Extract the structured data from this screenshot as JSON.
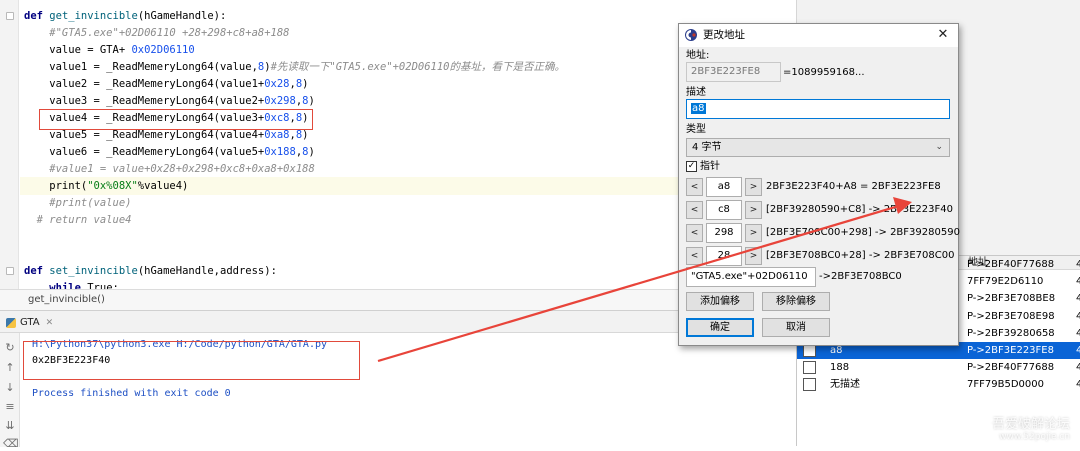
{
  "editor": {
    "lines": [
      {
        "parts": [
          [
            "kw",
            "def "
          ],
          [
            "fn",
            "get_invincible"
          ],
          [
            "plain",
            "(hGameHandle):"
          ]
        ]
      },
      {
        "parts": [
          [
            "cmt",
            "    #\"GTA5.exe\"+02D06110 +28+298+c8+a8+188"
          ]
        ]
      },
      {
        "parts": [
          [
            "plain",
            "    value = GTA+ "
          ],
          [
            "num",
            "0x02D06110"
          ]
        ]
      },
      {
        "parts": [
          [
            "plain",
            "    value1 = _ReadMemeryLong64(value,"
          ],
          [
            "num",
            "8"
          ],
          [
            "plain",
            ")"
          ],
          [
            "cmt",
            "#先读取一下\"GTA5.exe\"+02D06110的基址，看下是否正确。"
          ]
        ]
      },
      {
        "parts": [
          [
            "plain",
            "    value2 = _ReadMemeryLong64(value1+"
          ],
          [
            "num",
            "0x28"
          ],
          [
            "plain",
            ","
          ],
          [
            "num",
            "8"
          ],
          [
            "plain",
            ")"
          ]
        ]
      },
      {
        "parts": [
          [
            "plain",
            "    value3 = _ReadMemeryLong64(value2+"
          ],
          [
            "num",
            "0x298"
          ],
          [
            "plain",
            ","
          ],
          [
            "num",
            "8"
          ],
          [
            "plain",
            ")"
          ]
        ]
      },
      {
        "parts": [
          [
            "plain",
            "    value4 = _ReadMemeryLong64(value3+"
          ],
          [
            "num",
            "0xc8"
          ],
          [
            "plain",
            ","
          ],
          [
            "num",
            "8"
          ],
          [
            "plain",
            ")"
          ]
        ]
      },
      {
        "parts": [
          [
            "plain",
            "    value5 = _ReadMemeryLong64(value4+"
          ],
          [
            "num",
            "0xa8"
          ],
          [
            "plain",
            ","
          ],
          [
            "num",
            "8"
          ],
          [
            "plain",
            ")"
          ]
        ]
      },
      {
        "parts": [
          [
            "plain",
            "    value6 = _ReadMemeryLong64(value5+"
          ],
          [
            "num",
            "0x188"
          ],
          [
            "plain",
            ","
          ],
          [
            "num",
            "8"
          ],
          [
            "plain",
            ")"
          ]
        ]
      },
      {
        "parts": [
          [
            "cmt",
            "    #value1 = value+0x28+0x298+0xc8+0xa8+0x188"
          ]
        ]
      },
      {
        "parts": [
          [
            "plain",
            "    print("
          ],
          [
            "str",
            "\"0x%08X\""
          ],
          [
            "plain",
            "%value4)"
          ]
        ]
      },
      {
        "parts": [
          [
            "cmt",
            "    #print(value)"
          ]
        ]
      },
      {
        "parts": [
          [
            "cmt",
            "  # return value4"
          ]
        ]
      },
      {
        "parts": [
          [
            "plain",
            ""
          ]
        ]
      },
      {
        "parts": [
          [
            "plain",
            ""
          ]
        ]
      },
      {
        "parts": [
          [
            "kw",
            "def "
          ],
          [
            "fn",
            "set_invincible"
          ],
          [
            "plain",
            "(hGameHandle,address):"
          ]
        ]
      },
      {
        "parts": [
          [
            "plain",
            "    "
          ],
          [
            "kw",
            "while "
          ],
          [
            "plain",
            "True:"
          ]
        ]
      }
    ],
    "breadcrumb": "get_invincible()"
  },
  "run_panel": {
    "tab_label": "GTA",
    "command": "H:\\Python37\\python3.exe H:/Code/python/GTA/GTA.py",
    "output": "0x2BF3E223F40",
    "exit_message": "Process finished with exit code 0",
    "tool_icons": [
      "rerun-icon",
      "arrow-up-icon",
      "arrow-down-icon",
      "soft-wrap-icon",
      "sort-icon",
      "trash-icon"
    ]
  },
  "cheat_table": {
    "header_addr": "地址",
    "rows": [
      {
        "desc": "",
        "addr": "P->2BF40F77688",
        "ex": "4",
        "selected": false
      },
      {
        "desc": "",
        "addr": "7FF79E2D6110",
        "ex": "4",
        "selected": false
      },
      {
        "desc": "",
        "addr": "P->2BF3E708BE8",
        "ex": "4",
        "selected": false
      },
      {
        "desc": "",
        "addr": "P->2BF3E708E98",
        "ex": "4",
        "selected": false
      },
      {
        "desc": "c8",
        "addr": "P->2BF39280658",
        "ex": "4",
        "selected": false
      },
      {
        "desc": "a8",
        "addr": "P->2BF3E223FE8",
        "ex": "4",
        "selected": true
      },
      {
        "desc": "188",
        "addr": "P->2BF40F77688",
        "ex": "4",
        "selected": false
      },
      {
        "desc": "无描述",
        "addr": "7FF79B5D0000",
        "ex": "4",
        "selected": false
      }
    ]
  },
  "dialog": {
    "title": "更改地址",
    "address_label": "地址:",
    "address_value": "2BF3E223FE8",
    "address_result": "=1089959168...",
    "desc_label": "描述",
    "desc_value": "a8",
    "type_label": "类型",
    "type_value": "4 字节",
    "pointer_label": "指针",
    "offsets": [
      {
        "value": "a8",
        "text": "2BF3E223F40+A8 = 2BF3E223FE8"
      },
      {
        "value": "c8",
        "text": "[2BF39280590+C8] -> 2BF3E223F40"
      },
      {
        "value": "298",
        "text": "[2BF3E708C00+298] -> 2BF39280590"
      },
      {
        "value": "28",
        "text": "[2BF3E708BC0+28] -> 2BF3E708C00"
      }
    ],
    "base_value": "\"GTA5.exe\"+02D06110",
    "base_result": "->2BF3E708BC0",
    "add_offset": "添加偏移",
    "remove_offset": "移除偏移",
    "ok": "确定",
    "cancel": "取消",
    "btn_left": "<",
    "btn_right": ">"
  },
  "watermark": {
    "main": "吾爱破解论坛",
    "url": "www.52pojie.cn"
  },
  "colors": {
    "annotation_red": "#e14a3b",
    "selection_blue": "#0a64d6"
  }
}
